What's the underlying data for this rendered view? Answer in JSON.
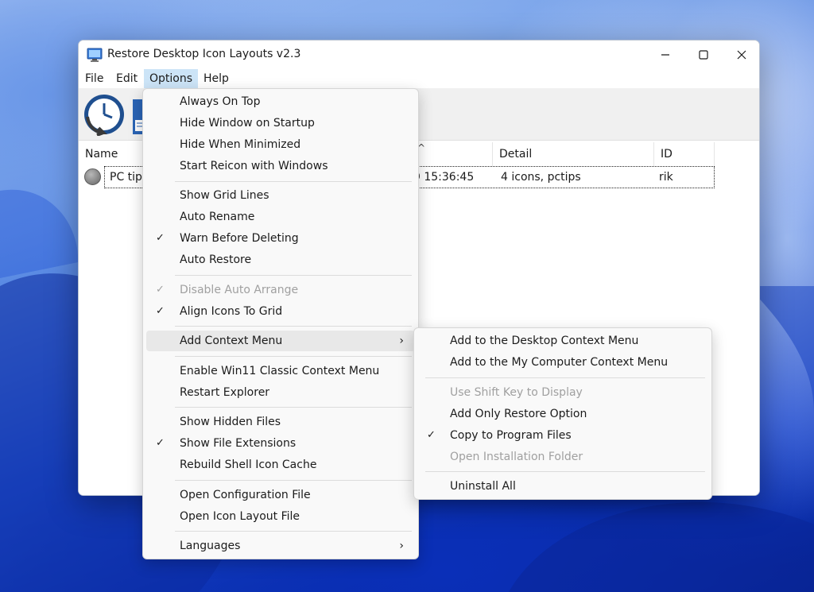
{
  "window": {
    "title": "Restore Desktop Icon Layouts v2.3",
    "minimize_icon": "minimize-icon",
    "maximize_icon": "maximize-icon",
    "close_icon": "close-icon"
  },
  "menubar": {
    "items": [
      "File",
      "Edit",
      "Options",
      "Help"
    ],
    "active": "Options"
  },
  "toolbar": {
    "buttons": [
      "clock-restore-icon",
      "save-disk-icon"
    ]
  },
  "list": {
    "columns": [
      "Name",
      "Detail",
      "ID"
    ],
    "sort_indicator": "^",
    "rows": [
      {
        "name": "PC tip",
        "date": "9 15:36:45",
        "detail": "4 icons, pctips",
        "id": "rik",
        "status_color": "#8a8a8a"
      }
    ]
  },
  "options_menu": {
    "groups": [
      [
        {
          "label": "Always On Top",
          "checked": false,
          "enabled": true
        },
        {
          "label": "Hide Window on Startup",
          "checked": false,
          "enabled": true
        },
        {
          "label": "Hide When Minimized",
          "checked": false,
          "enabled": true
        },
        {
          "label": "Start Reicon with Windows",
          "checked": false,
          "enabled": true
        }
      ],
      [
        {
          "label": "Show Grid Lines",
          "checked": false,
          "enabled": true
        },
        {
          "label": "Auto Rename",
          "checked": false,
          "enabled": true
        },
        {
          "label": "Warn Before Deleting",
          "checked": true,
          "enabled": true
        },
        {
          "label": "Auto Restore",
          "checked": false,
          "enabled": true
        }
      ],
      [
        {
          "label": "Disable Auto Arrange",
          "checked": true,
          "enabled": false
        },
        {
          "label": "Align Icons To Grid",
          "checked": true,
          "enabled": true
        }
      ],
      [
        {
          "label": "Add Context Menu",
          "checked": false,
          "enabled": true,
          "submenu": true,
          "highlighted": true
        }
      ],
      [
        {
          "label": "Enable Win11 Classic Context Menu",
          "checked": false,
          "enabled": true
        },
        {
          "label": "Restart Explorer",
          "checked": false,
          "enabled": true
        }
      ],
      [
        {
          "label": "Show Hidden Files",
          "checked": false,
          "enabled": true
        },
        {
          "label": "Show File Extensions",
          "checked": true,
          "enabled": true
        },
        {
          "label": "Rebuild Shell Icon Cache",
          "checked": false,
          "enabled": true
        }
      ],
      [
        {
          "label": "Open Configuration File",
          "checked": false,
          "enabled": true
        },
        {
          "label": "Open Icon Layout File",
          "checked": false,
          "enabled": true
        }
      ],
      [
        {
          "label": "Languages",
          "checked": false,
          "enabled": true,
          "submenu": true
        }
      ]
    ]
  },
  "context_submenu": {
    "groups": [
      [
        {
          "label": "Add to the Desktop Context Menu",
          "checked": false,
          "enabled": true
        },
        {
          "label": "Add to the My Computer Context Menu",
          "checked": false,
          "enabled": true
        }
      ],
      [
        {
          "label": "Use Shift Key to Display",
          "checked": false,
          "enabled": false
        },
        {
          "label": "Add Only Restore Option",
          "checked": false,
          "enabled": true
        },
        {
          "label": "Copy to Program Files",
          "checked": true,
          "enabled": true
        },
        {
          "label": "Open Installation Folder",
          "checked": false,
          "enabled": false
        }
      ],
      [
        {
          "label": "Uninstall All",
          "checked": false,
          "enabled": true
        }
      ]
    ]
  },
  "glyphs": {
    "check": "✓",
    "submenu_arrow": "›"
  }
}
